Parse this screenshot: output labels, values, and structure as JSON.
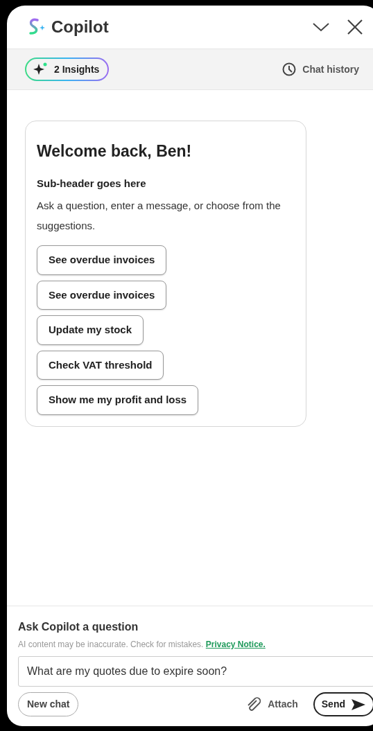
{
  "header": {
    "title": "Copilot"
  },
  "toolbar": {
    "insights": "2 Insights",
    "insights_dot": true,
    "history": "Chat history"
  },
  "welcome": {
    "title": "Welcome back, Ben!",
    "subheader": "Sub-header goes here",
    "body": "Ask a question, enter a message, or choose from the suggestions.",
    "suggestions": [
      "See overdue invoices",
      "See overdue invoices",
      "Update my stock",
      "Check VAT threshold",
      "Show me my profit and loss"
    ]
  },
  "composer": {
    "title": "Ask Copilot a question",
    "disclaimer": "AI content may be inaccurate. Check for mistakes.",
    "link": "Privacy Notice.",
    "value": "What are my quotes due to expire soon?",
    "new_chat": "New chat",
    "attach": "Attach",
    "send": "Send"
  }
}
